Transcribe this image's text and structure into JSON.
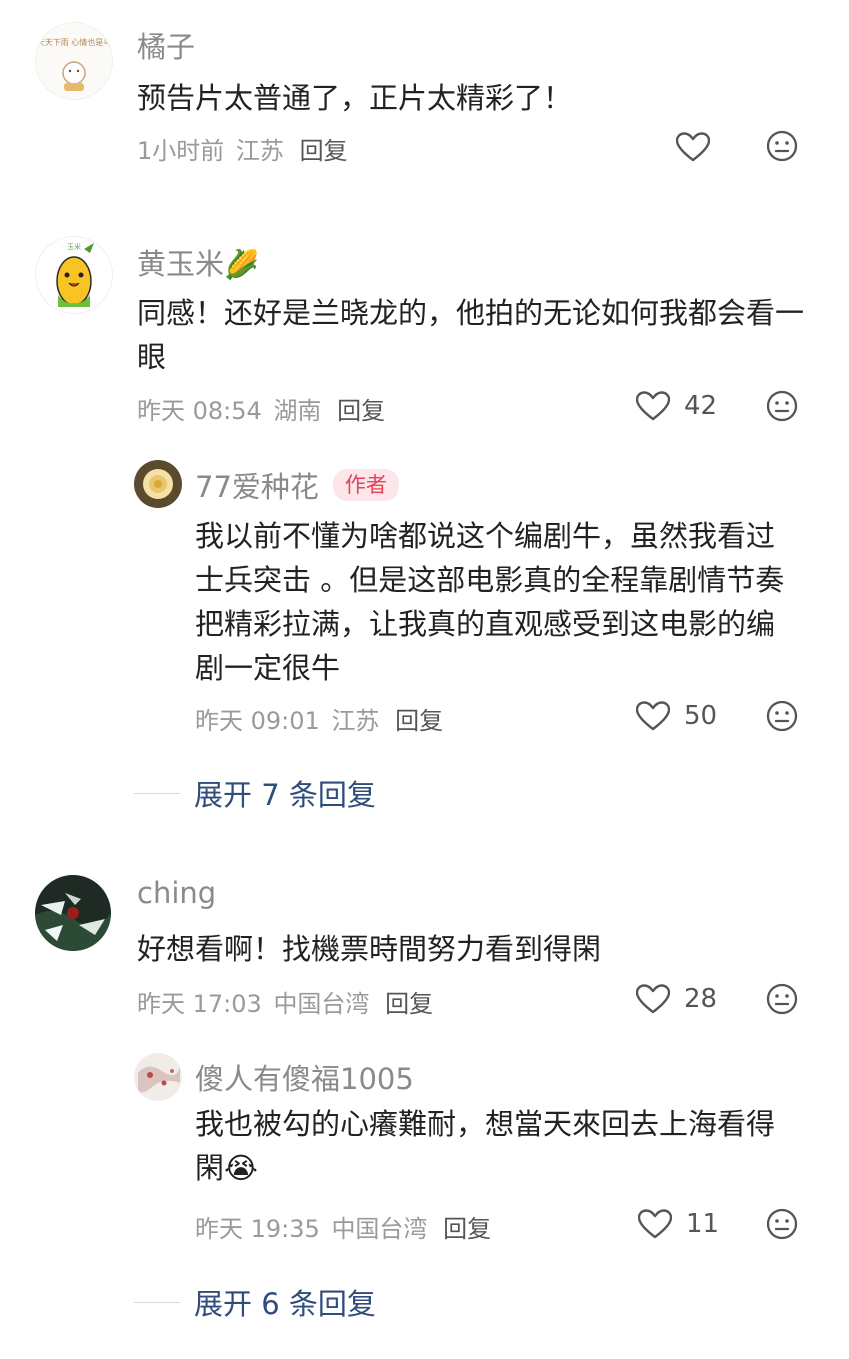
{
  "comments": [
    {
      "user": "橘子",
      "avatar_text": "天天下雨 心情也是乌",
      "text": "预告片太普通了，正片太精彩了！",
      "time": "1小时前",
      "region": "江苏",
      "reply_label": "回复",
      "likes": ""
    },
    {
      "user": "黄玉米",
      "avatar_text": "玉米",
      "user_emoji": "🌽",
      "text": "同感！还好是兰晓龙的，他拍的无论如何我都会看一眼",
      "time": "昨天 08:54",
      "region": "湖南",
      "reply_label": "回复",
      "likes": "42",
      "replies": [
        {
          "user": "77爱种花",
          "badge": "作者",
          "text": "我以前不懂为啥都说这个编剧牛，虽然我看过士兵突击 。但是这部电影真的全程靠剧情节奏把精彩拉满，让我真的直观感受到这电影的编剧一定很牛",
          "time": "昨天 09:01",
          "region": "江苏",
          "reply_label": "回复",
          "likes": "50"
        }
      ],
      "expand_label": "展开 7 条回复"
    },
    {
      "user": "ching",
      "text": "好想看啊！找機票時間努力看到得閑",
      "time": "昨天 17:03",
      "region": "中国台湾",
      "reply_label": "回复",
      "likes": "28",
      "replies": [
        {
          "user": "傻人有傻福1005",
          "text": "我也被勾的心癢難耐，想當天來回去上海看得閑",
          "text_emoji": "😭",
          "time": "昨天 19:35",
          "region": "中国台湾",
          "reply_label": "回复",
          "likes": "11"
        }
      ],
      "expand_label": "展开 6 条回复"
    }
  ],
  "icons": {
    "like": "heart-outline-icon",
    "react": "neutral-face-icon"
  },
  "colors": {
    "author_badge_bg": "#fde6e9",
    "author_badge_text": "#e0455a",
    "expand_link": "#2f4c7a",
    "meta": "#9a9a9a"
  }
}
